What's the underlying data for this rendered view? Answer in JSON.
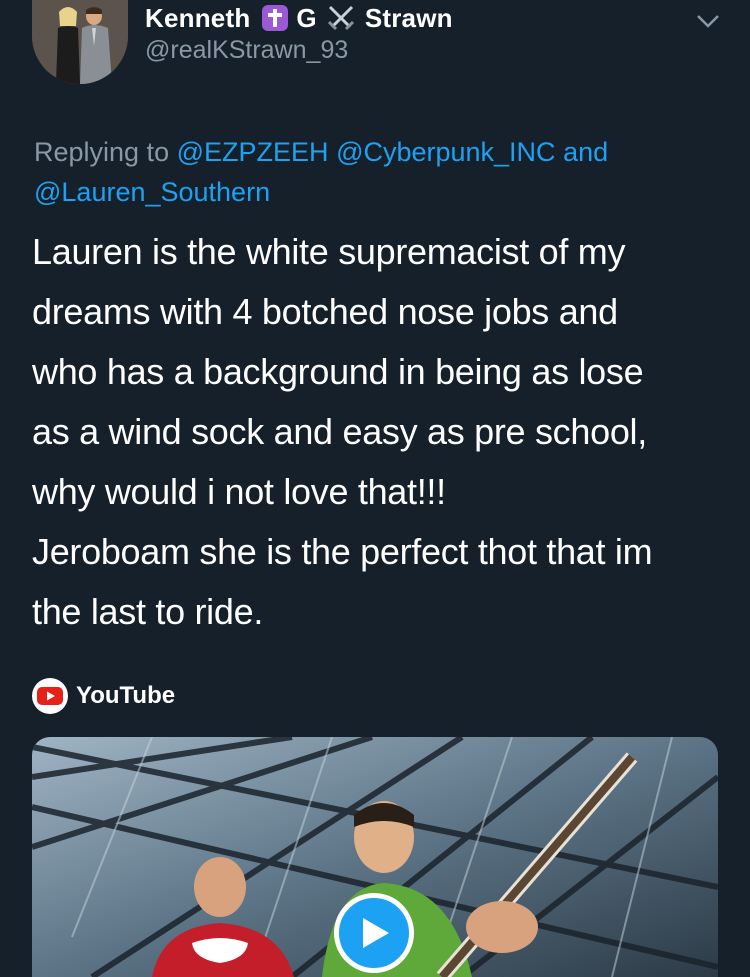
{
  "author": {
    "name_parts": [
      "Kenneth",
      "G",
      "Strawn"
    ],
    "handle": "@realKStrawn_93",
    "icons": [
      "latin-cross-icon",
      "crossed-swords-icon"
    ]
  },
  "reply": {
    "prefix": "Replying to",
    "mentions": [
      "@EZPZEEH",
      "@Cyberpunk_INC"
    ],
    "conjunction": "and",
    "last_mention": "@Lauren_Southern"
  },
  "body": {
    "lines": [
      "Lauren is the white supremacist of my",
      "dreams with 4 botched nose jobs and",
      "who has a background in being as lose",
      "as a wind sock and easy as pre school,",
      "why would i not love that!!!",
      "Jeroboam she is the perfect thot that im",
      "the last to ride."
    ]
  },
  "card": {
    "source": "YouTube"
  },
  "colors": {
    "background": "#15202b",
    "accent": "#1da1f2",
    "secondary_text": "#8899a6"
  }
}
